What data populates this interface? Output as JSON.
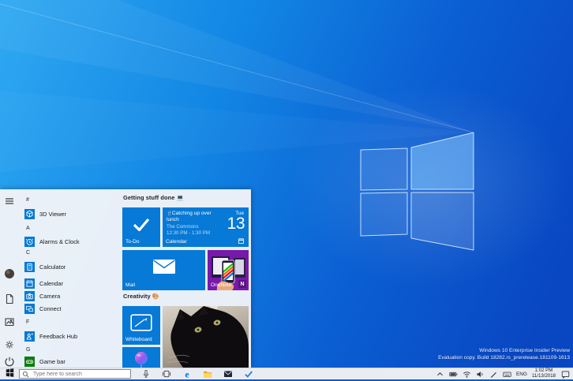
{
  "desktop": {
    "watermark": {
      "line1": "Windows 10 Enterprise Insider Preview",
      "line2": "Evaluation copy. Build 18282.rs_prerelease.181109-1613"
    }
  },
  "start_menu": {
    "rail_items": [
      "menu",
      "user",
      "documents",
      "pictures",
      "settings",
      "power"
    ],
    "app_list": [
      {
        "type": "header",
        "label": "#"
      },
      {
        "type": "app",
        "label": "3D Viewer"
      },
      {
        "type": "header",
        "label": "A"
      },
      {
        "type": "app",
        "label": "Alarms & Clock"
      },
      {
        "type": "header",
        "label": "C"
      },
      {
        "type": "app",
        "label": "Calculator"
      },
      {
        "type": "app",
        "label": "Calendar"
      },
      {
        "type": "app",
        "label": "Camera"
      },
      {
        "type": "app",
        "label": "Connect"
      },
      {
        "type": "header",
        "label": "F"
      },
      {
        "type": "app",
        "label": "Feedback Hub"
      },
      {
        "type": "header",
        "label": "G"
      },
      {
        "type": "app",
        "label": "Game bar"
      }
    ],
    "groups": [
      {
        "title": "Getting stuff done 💻"
      },
      {
        "title": "Creativity 🎨"
      }
    ],
    "tiles": {
      "todo": {
        "label": "To-Do"
      },
      "calendar": {
        "event_icon": "🍴",
        "event": "Catching up over lunch",
        "location": "The Commons",
        "time": "12:30 PM - 1:30 PM",
        "weekday": "Tue",
        "day": "13",
        "label": "Calendar"
      },
      "mail": {
        "label": "Mail"
      },
      "onenote": {
        "label": "OneNote",
        "logo_letter": "N"
      },
      "whiteboard": {
        "label": "Whiteboard"
      }
    }
  },
  "taskbar": {
    "search_placeholder": "Type here to search",
    "edge_letter": "e",
    "tray": {
      "language": "ENG",
      "time": "1:02 PM",
      "date": "11/13/2018"
    }
  },
  "colors": {
    "accent": "#0078d7",
    "onenote_purple": "#7719aa",
    "game_bar_green": "#107c10",
    "wallpaper_light": "#2fa9f2",
    "wallpaper_dark": "#0947c2"
  }
}
